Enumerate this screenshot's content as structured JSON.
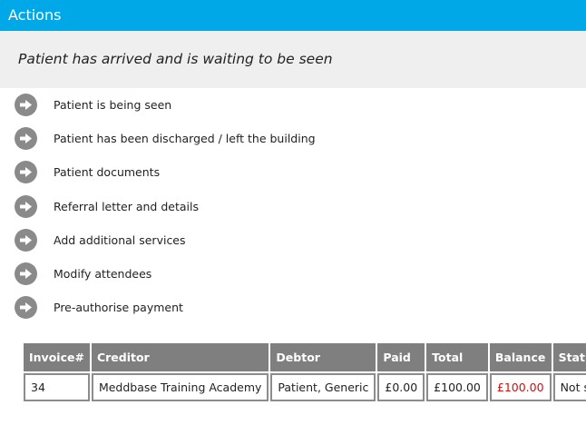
{
  "header": {
    "title": "Actions",
    "background_color": "#00a8e8"
  },
  "status": {
    "text": "Patient has arrived and is waiting to be seen"
  },
  "actions": [
    {
      "label": "Patient is being seen",
      "icon": "arrow-right-circle-icon"
    },
    {
      "label": "Patient has been discharged / left the building",
      "icon": "arrow-right-circle-icon"
    },
    {
      "label": "Patient documents",
      "icon": "arrow-right-circle-icon"
    },
    {
      "label": "Referral letter and details",
      "icon": "arrow-right-circle-icon"
    },
    {
      "label": "Add additional services",
      "icon": "arrow-right-circle-icon"
    },
    {
      "label": "Modify attendees",
      "icon": "arrow-right-circle-icon"
    },
    {
      "label": "Pre-authorise payment",
      "icon": "arrow-right-circle-icon"
    }
  ],
  "invoices": {
    "columns": [
      "Invoice#",
      "Creditor",
      "Debtor",
      "Paid",
      "Total",
      "Balance",
      "Status"
    ],
    "rows": [
      {
        "invoice": "34",
        "creditor": "Meddbase Training Academy",
        "debtor": "Patient, Generic",
        "paid": "£0.00",
        "total": "£100.00",
        "balance": "£100.00",
        "status": "Not sent"
      }
    ],
    "balance_color": "#cc1111",
    "header_color": "#7f7f7f"
  }
}
